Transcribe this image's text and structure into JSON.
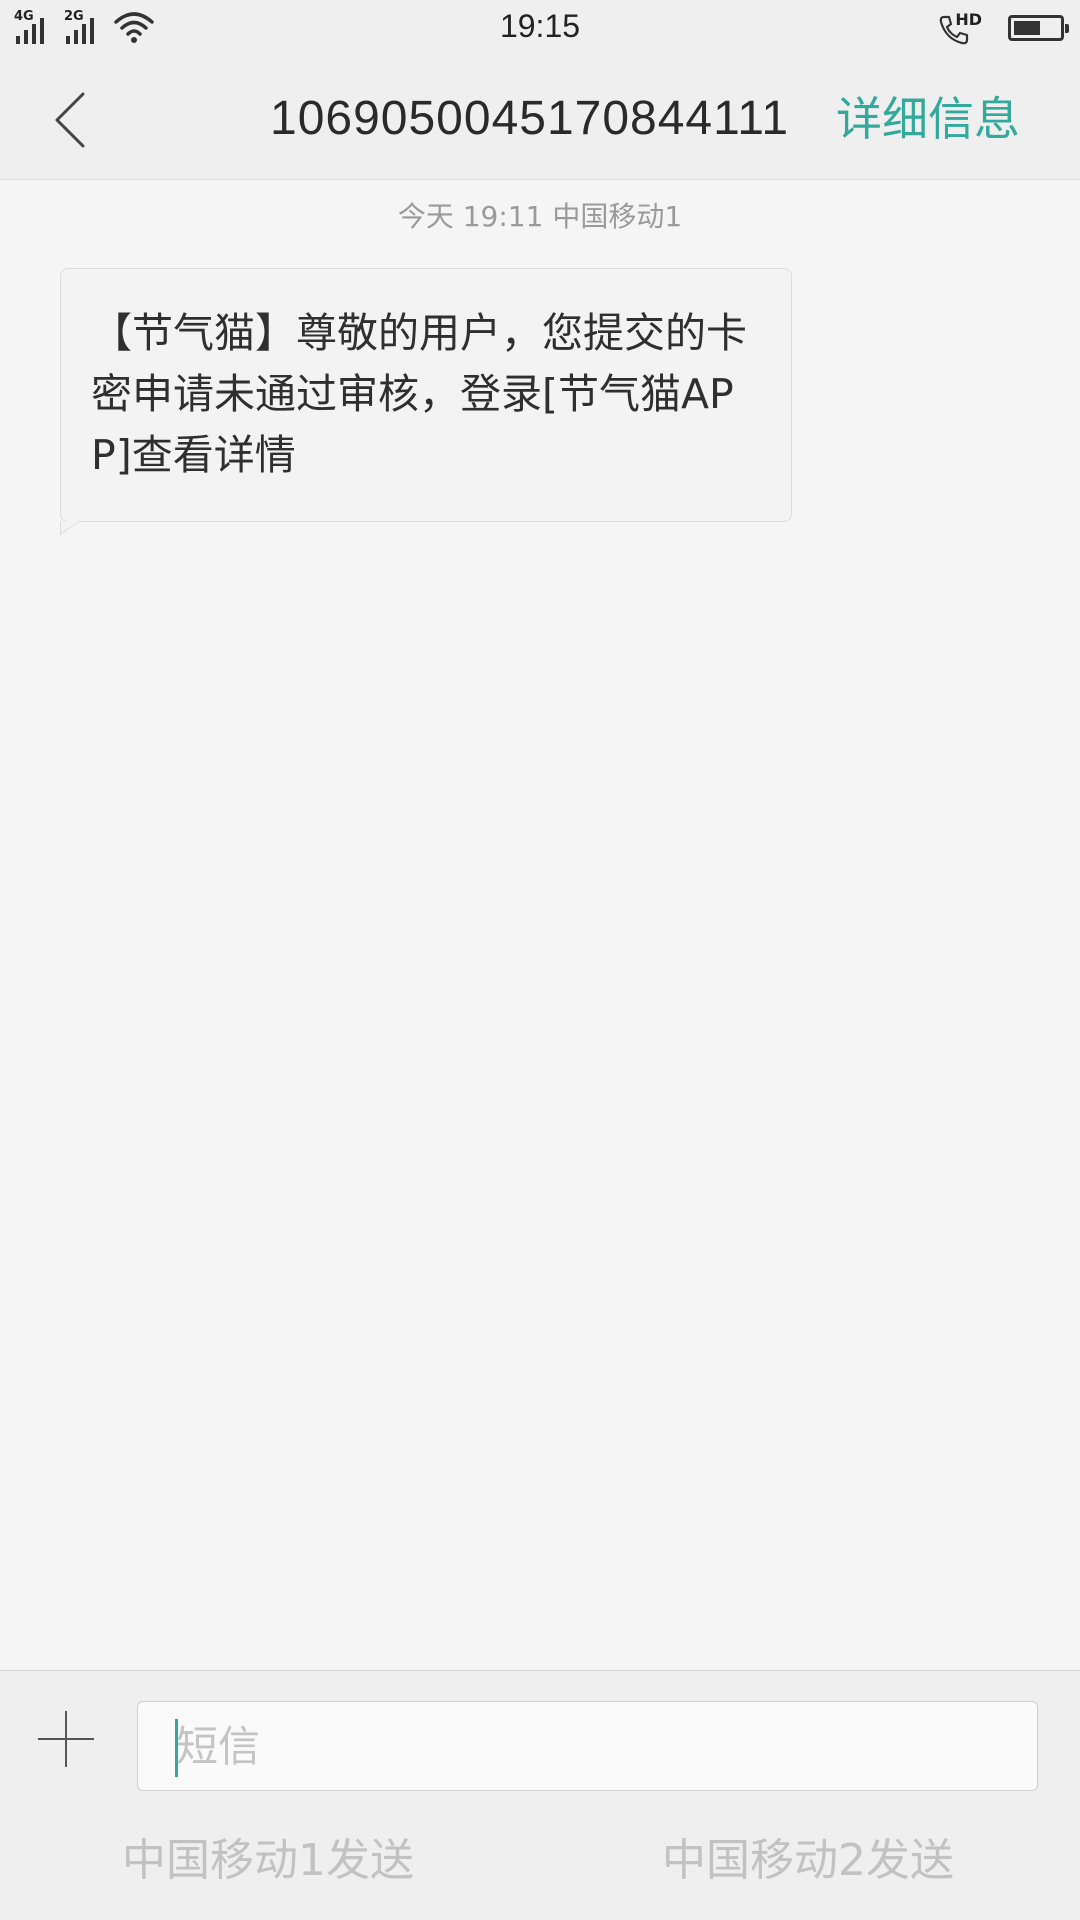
{
  "status_bar": {
    "sim1_network": "4G",
    "sim2_network": "2G",
    "time": "19:15",
    "call_badge": "HD",
    "battery_level": 0.6
  },
  "header": {
    "title": "1069050045170844111",
    "details_label": "详细信息"
  },
  "conversation": {
    "timestamp": "今天  19:11  中国移动1",
    "messages": [
      {
        "text": "【节气猫】尊敬的用户，您提交的卡密申请未通过审核，登录[节气猫APP]查看详情"
      }
    ]
  },
  "composer": {
    "placeholder": "短信",
    "value": "",
    "send_sim1_label": "中国移动1发送",
    "send_sim2_label": "中国移动2发送"
  },
  "colors": {
    "accent": "#33a99c",
    "background": "#f5f5f5",
    "bar": "#efefef"
  }
}
